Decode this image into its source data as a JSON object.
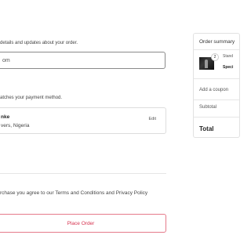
{
  "contact": {
    "help_text": " details and updates about your order.",
    "email_value": "om"
  },
  "billing": {
    "help_text": "atches your payment method.",
    "address_name": "nke",
    "address_location": "vers, Nigeria",
    "edit_label": "Edit"
  },
  "terms": {
    "prefix": "rchase you agree to our ",
    "terms_link": "Terms and Conditions",
    "and": " and ",
    "privacy_link": "Privacy Policy"
  },
  "actions": {
    "place_order_label": "Place Order"
  },
  "summary": {
    "title": "Order summary",
    "item": {
      "quantity": "2",
      "name": "Stand",
      "variant": "Speci"
    },
    "coupon_label": "Add a coupon",
    "subtotal_label": "Subtotal",
    "total_label": "Total"
  },
  "colors": {
    "accent": "#d6334f",
    "accent_border": "#e57a8a"
  }
}
